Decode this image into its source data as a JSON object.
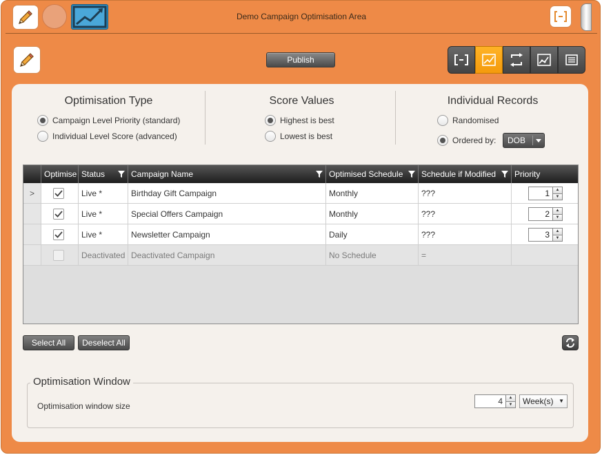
{
  "window": {
    "title": "Demo Campaign Optimisation Area"
  },
  "toolbar": {
    "publish_label": "Publish"
  },
  "optimisation_type": {
    "title": "Optimisation Type",
    "options": [
      {
        "label": "Campaign Level Priority (standard)",
        "selected": true
      },
      {
        "label": "Individual Level Score (advanced)",
        "selected": false
      }
    ]
  },
  "score_values": {
    "title": "Score Values",
    "options": [
      {
        "label": "Highest is best",
        "selected": true
      },
      {
        "label": "Lowest is best",
        "selected": false
      }
    ]
  },
  "individual_records": {
    "title": "Individual Records",
    "options": [
      {
        "label": "Randomised",
        "selected": false
      },
      {
        "label": "Ordered by:",
        "selected": true
      }
    ],
    "order_by_value": "DOB"
  },
  "grid": {
    "columns": [
      "Optimise",
      "Status",
      "Campaign Name",
      "Optimised Schedule",
      "Schedule if Modified",
      "Priority"
    ],
    "rows": [
      {
        "selector": ">",
        "optimise": true,
        "status": "Live *",
        "name": "Birthday Gift Campaign",
        "schedule": "Monthly",
        "modified": "???",
        "priority": "1"
      },
      {
        "selector": "",
        "optimise": true,
        "status": "Live *",
        "name": "Special Offers Campaign",
        "schedule": "Monthly",
        "modified": "???",
        "priority": "2"
      },
      {
        "selector": "",
        "optimise": true,
        "status": "Live *",
        "name": "Newsletter Campaign",
        "schedule": "Daily",
        "modified": "???",
        "priority": "3"
      },
      {
        "selector": "",
        "optimise": false,
        "status": "Deactivated",
        "name": "Deactivated Campaign",
        "schedule": "No Schedule",
        "modified": "=",
        "priority": ""
      }
    ]
  },
  "actions": {
    "select_all": "Select All",
    "deselect_all": "Deselect All"
  },
  "optimisation_window": {
    "legend": "Optimisation Window",
    "label": "Optimisation window size",
    "value": "4",
    "unit": "Week(s)"
  },
  "colors": {
    "frame": "#ee8a47",
    "panel": "#f5f1ec",
    "active_view": "#f9a51b",
    "header": "#2b2b2b"
  }
}
